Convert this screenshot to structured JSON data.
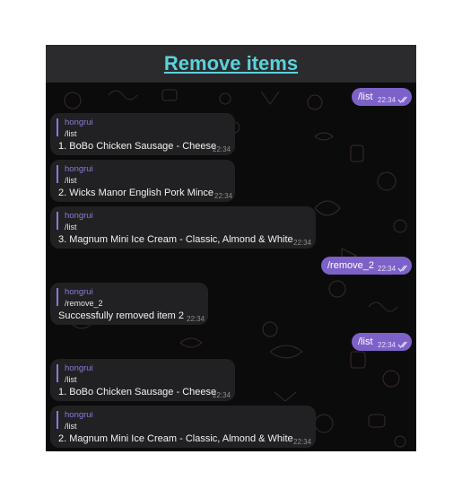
{
  "header": {
    "title": "Remove items"
  },
  "messages": [
    {
      "direction": "outgoing",
      "text": "/list",
      "time": "22:34",
      "status": "read"
    },
    {
      "direction": "incoming",
      "sender": "hongrui",
      "reply_to": "/list",
      "text": "1. BoBo Chicken Sausage - Cheese",
      "time": "22:34"
    },
    {
      "direction": "incoming",
      "sender": "hongrui",
      "reply_to": "/list",
      "text": "2. Wicks Manor English Pork Mince",
      "time": "22:34"
    },
    {
      "direction": "incoming",
      "sender": "hongrui",
      "reply_to": "/list",
      "text": "3. Magnum Mini Ice Cream - Classic, Almond & White",
      "time": "22:34"
    },
    {
      "direction": "outgoing",
      "text": "/remove_2",
      "time": "22:34",
      "status": "read"
    },
    {
      "direction": "incoming",
      "sender": "hongrui",
      "reply_to": "/remove_2",
      "text": "Successfully removed item 2",
      "time": "22:34"
    },
    {
      "direction": "outgoing",
      "text": "/list",
      "time": "22:34",
      "status": "read"
    },
    {
      "direction": "incoming",
      "sender": "hongrui",
      "reply_to": "/list",
      "text": "1. BoBo Chicken Sausage - Cheese",
      "time": "22:34"
    },
    {
      "direction": "incoming",
      "sender": "hongrui",
      "reply_to": "/list",
      "text": "2. Magnum Mini Ice Cream - Classic, Almond & White",
      "time": "22:34"
    }
  ],
  "colors": {
    "header_title": "#5ad2db",
    "outgoing_bubble": "#7c62c8",
    "incoming_bubble": "#212123",
    "sender_name": "#8d78d8",
    "chat_background": "#0b0b0c"
  },
  "icons": {
    "read_receipt": "double-check-icon"
  }
}
